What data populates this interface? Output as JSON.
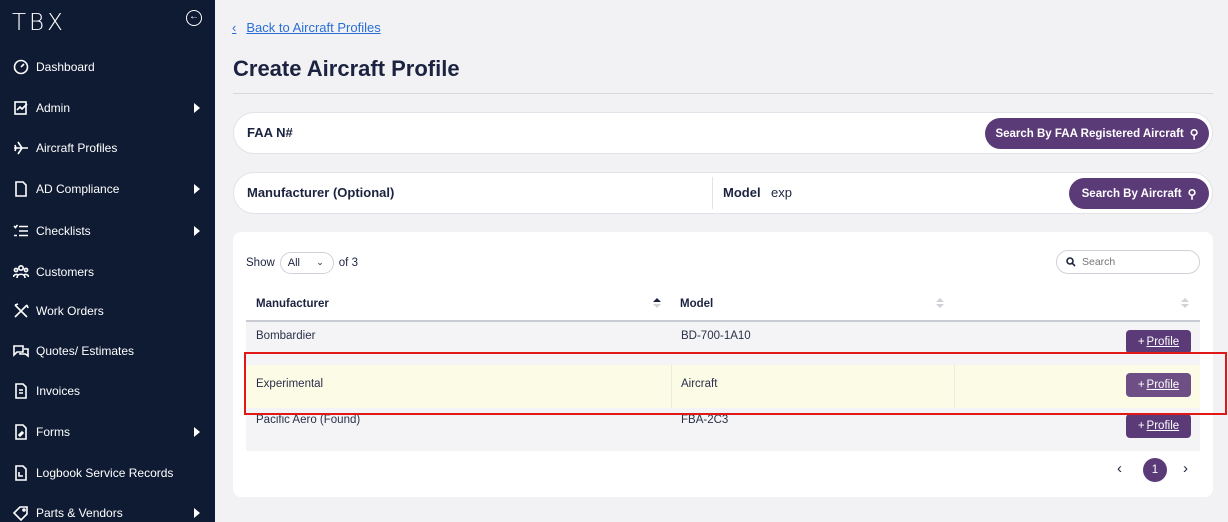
{
  "brand": {
    "logo": "TBX",
    "accent": "#5b3a78",
    "sidebar_bg": "#0f1b33"
  },
  "sidebar": {
    "collapse_icon": "collapse-left-icon",
    "items": [
      {
        "label": "Dashboard",
        "icon": "gauge-icon",
        "has_submenu": false
      },
      {
        "label": "Admin",
        "icon": "admin-chart-icon",
        "has_submenu": true
      },
      {
        "label": "Aircraft Profiles",
        "icon": "airplane-icon",
        "has_submenu": false
      },
      {
        "label": "AD Compliance",
        "icon": "document-icon",
        "has_submenu": true
      },
      {
        "label": "Checklists",
        "icon": "checklist-icon",
        "has_submenu": true
      },
      {
        "label": "Customers",
        "icon": "customers-icon",
        "has_submenu": false
      },
      {
        "label": "Work Orders",
        "icon": "tools-icon",
        "has_submenu": false
      },
      {
        "label": "Quotes/ Estimates",
        "icon": "chat-icon",
        "has_submenu": false
      },
      {
        "label": "Invoices",
        "icon": "invoice-icon",
        "has_submenu": false
      },
      {
        "label": "Forms",
        "icon": "forms-icon",
        "has_submenu": true
      },
      {
        "label": "Logbook Service Records",
        "icon": "logbook-icon",
        "has_submenu": false
      },
      {
        "label": "Parts & Vendors",
        "icon": "tag-icon",
        "has_submenu": true
      }
    ]
  },
  "main": {
    "back_link": "Back to Aircraft Profiles",
    "title": "Create Aircraft Profile",
    "faa_search": {
      "label": "FAA N#",
      "value": "",
      "button": "Search By FAA Registered Aircraft"
    },
    "aircraft_search": {
      "manufacturer_label": "Manufacturer (Optional)",
      "manufacturer_value": "",
      "model_label": "Model",
      "model_value": "exp",
      "button": "Search By Aircraft"
    },
    "table": {
      "show_label": "Show",
      "show_value": "All",
      "of_label": "of 3",
      "search_placeholder": "Search",
      "columns": [
        "Manufacturer",
        "Model",
        ""
      ],
      "rows": [
        {
          "manufacturer": "Bombardier",
          "model": "BD-700-1A10",
          "action": "Profile"
        },
        {
          "manufacturer": "Experimental",
          "model": "Aircraft",
          "action": "Profile"
        },
        {
          "manufacturer": "Pacific Aero (Found)",
          "model": "FBA-2C3",
          "action": "Profile"
        }
      ],
      "pagination": {
        "current_page": "1"
      }
    }
  }
}
